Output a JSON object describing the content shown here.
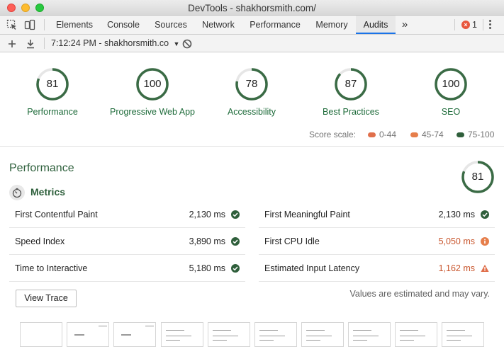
{
  "window": {
    "title": "DevTools - shakhorsmith.com/"
  },
  "tabs": [
    {
      "label": "Elements"
    },
    {
      "label": "Console"
    },
    {
      "label": "Sources"
    },
    {
      "label": "Network"
    },
    {
      "label": "Performance"
    },
    {
      "label": "Memory"
    },
    {
      "label": "Audits",
      "active": true
    }
  ],
  "toolbar": {
    "overflow_glyph": "»",
    "error_count": "1",
    "report_label": "7:12:24 PM - shakhorsmith.co"
  },
  "scores": [
    {
      "label": "Performance",
      "value": 81
    },
    {
      "label": "Progressive Web App",
      "value": 100
    },
    {
      "label": "Accessibility",
      "value": 78
    },
    {
      "label": "Best Practices",
      "value": 87
    },
    {
      "label": "SEO",
      "value": 100
    }
  ],
  "score_scale": {
    "label": "Score scale:",
    "ranges": [
      "0-44",
      "45-74",
      "75-100"
    ]
  },
  "performance": {
    "title": "Performance",
    "score": 81,
    "metrics_title": "Metrics",
    "metrics": [
      {
        "label": "First Contentful Paint",
        "value": "2,130 ms",
        "status": "pass"
      },
      {
        "label": "First Meaningful Paint",
        "value": "2,130 ms",
        "status": "pass"
      },
      {
        "label": "Speed Index",
        "value": "3,890 ms",
        "status": "pass"
      },
      {
        "label": "First CPU Idle",
        "value": "5,050 ms",
        "status": "average"
      },
      {
        "label": "Time to Interactive",
        "value": "5,180 ms",
        "status": "pass"
      },
      {
        "label": "Estimated Input Latency",
        "value": "1,162 ms",
        "status": "fail"
      }
    ],
    "view_trace_label": "View Trace",
    "estimate_note": "Values are estimated and may vary."
  },
  "colors": {
    "pass": "#1e7e34",
    "average": "#e67700",
    "fail": "#e05a2b",
    "gauge_pass": "#3a6b45",
    "accent": "#1a73e8"
  }
}
